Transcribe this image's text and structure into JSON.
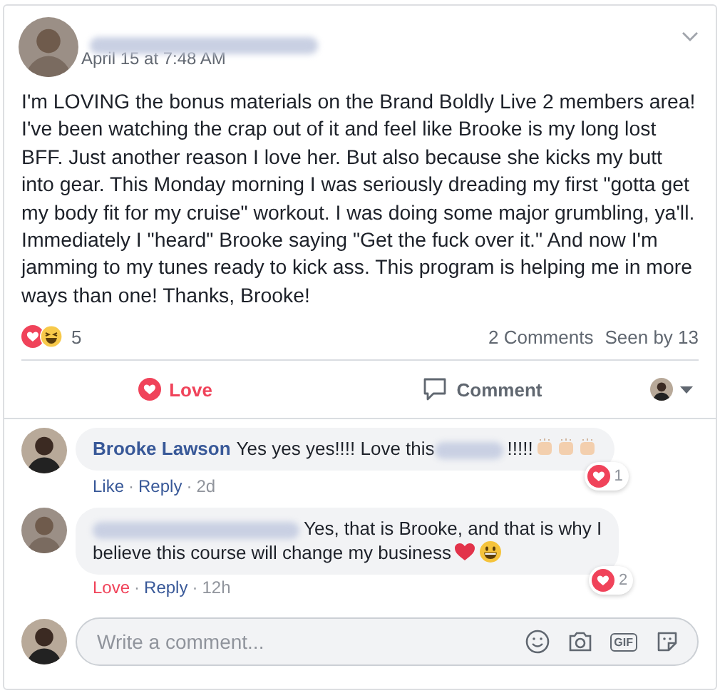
{
  "post": {
    "timestamp": "April 15 at 7:48 AM",
    "author_blurred": true,
    "body": "I'm LOVING the bonus materials on the Brand Boldly Live 2 members area! I've been watching the crap out of it and feel like Brooke is my long lost BFF. Just another reason I love her. But also because she kicks my butt into gear. This Monday morning I was seriously dreading my first \"gotta get my body fit for my cruise\" workout. I was doing some major grumbling, ya'll. Immediately I \"heard\" Brooke saying \"Get the fuck over it.\" And now I'm jamming to my tunes ready to kick ass. This program is helping me in more ways than one! Thanks, Brooke!",
    "reaction_count": "5",
    "comments_count": "2 Comments",
    "seen_by": "Seen by 13"
  },
  "actions": [
    {
      "kind": "love",
      "label": "Love",
      "selected": true
    },
    {
      "kind": "comment",
      "label": "Comment",
      "selected": false
    }
  ],
  "comments": [
    {
      "author": "Brooke Lawson",
      "lines": [
        "Yes yes yes!!!! Love this"
      ],
      "text_after": "!!!!!",
      "icons": [
        {
          "kind": "clap"
        },
        {
          "kind": "clap"
        },
        {
          "kind": "clap"
        }
      ],
      "meta": [
        {
          "kind": "reaction",
          "text": "Like",
          "selected": false
        },
        {
          "kind": "dot",
          "text": "·"
        },
        {
          "kind": "link",
          "text": "Reply"
        },
        {
          "kind": "dot",
          "text": "·"
        },
        {
          "kind": "time",
          "text": "2d"
        }
      ],
      "love_count": "1"
    },
    {
      "author_blurred": true,
      "lines": [
        "Yes, that is Brooke, and that is why I",
        "believe this course will change my business"
      ],
      "icons": [
        {
          "kind": "heart"
        },
        {
          "kind": "grin"
        }
      ],
      "meta": [
        {
          "kind": "reaction",
          "text": "Love",
          "selected": true
        },
        {
          "kind": "dot",
          "text": "·"
        },
        {
          "kind": "link",
          "text": "Reply"
        },
        {
          "kind": "dot",
          "text": "·"
        },
        {
          "kind": "time",
          "text": "12h"
        }
      ],
      "love_count": "2"
    }
  ],
  "composer": {
    "placeholder": "Write a comment...",
    "gif_label": "GIF"
  }
}
